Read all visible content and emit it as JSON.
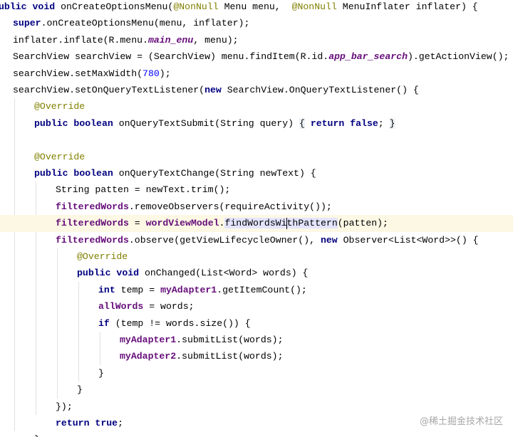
{
  "editor": {
    "lines": [
      {
        "id": "l1",
        "parts": [
          {
            "t": "ublic",
            "c": "kw"
          },
          {
            "t": " "
          },
          {
            "t": "void",
            "c": "kw"
          },
          {
            "t": " onCreateOptionsMenu("
          },
          {
            "t": "@NonNull",
            "c": "ann"
          },
          {
            "t": " Menu menu,  "
          },
          {
            "t": "@NonNull",
            "c": "ann"
          },
          {
            "t": " MenuInflater inflater) {"
          }
        ]
      },
      {
        "id": "l2",
        "parts": [
          {
            "t": "super",
            "c": "kw"
          },
          {
            "t": ".onCreateOptionsMenu(menu, inflater);"
          }
        ]
      },
      {
        "id": "l3",
        "parts": [
          {
            "t": "inflater.inflate(R.menu."
          },
          {
            "t": "main_enu",
            "c": "field-it"
          },
          {
            "t": ", menu);"
          }
        ]
      },
      {
        "id": "l4",
        "parts": [
          {
            "t": "SearchView searchView = (SearchView) menu.findItem(R.id."
          },
          {
            "t": "app_bar_search",
            "c": "field-it"
          },
          {
            "t": ").getActionView();"
          }
        ]
      },
      {
        "id": "l5",
        "parts": [
          {
            "t": "searchView.setMaxWidth("
          },
          {
            "t": "780",
            "c": "num"
          },
          {
            "t": ");"
          }
        ]
      },
      {
        "id": "l6",
        "parts": [
          {
            "t": "searchView.setOnQueryTextListener("
          },
          {
            "t": "new",
            "c": "kw"
          },
          {
            "t": " SearchView.OnQueryTextListener() {"
          }
        ]
      },
      {
        "id": "l7",
        "parts": [
          {
            "t": "@Override",
            "c": "ann"
          }
        ]
      },
      {
        "id": "l8",
        "parts": [
          {
            "t": "public",
            "c": "kw"
          },
          {
            "t": " "
          },
          {
            "t": "boolean",
            "c": "kw"
          },
          {
            "t": " onQueryTextSubmit(String query) "
          },
          {
            "t": "{",
            "c": "brace-hl"
          },
          {
            "t": " "
          },
          {
            "t": "return",
            "c": "kw"
          },
          {
            "t": " "
          },
          {
            "t": "false",
            "c": "kw"
          },
          {
            "t": "; "
          },
          {
            "t": "}",
            "c": "brace-hl"
          }
        ]
      },
      {
        "id": "l9",
        "parts": []
      },
      {
        "id": "l10",
        "parts": [
          {
            "t": "@Override",
            "c": "ann"
          }
        ]
      },
      {
        "id": "l11",
        "parts": [
          {
            "t": "public",
            "c": "kw"
          },
          {
            "t": " "
          },
          {
            "t": "boolean",
            "c": "kw"
          },
          {
            "t": " onQueryTextChange(String newText) {"
          }
        ]
      },
      {
        "id": "l12",
        "parts": [
          {
            "t": "String patten = newText.trim();"
          }
        ]
      },
      {
        "id": "l13",
        "parts": [
          {
            "t": "filteredWords",
            "c": "field"
          },
          {
            "t": ".removeObservers(requireActivity());"
          }
        ]
      },
      {
        "id": "l14",
        "parts": [
          {
            "t": "filteredWords",
            "c": "field"
          },
          {
            "t": " = "
          },
          {
            "t": "wordViewModel",
            "c": "field"
          },
          {
            "t": "."
          },
          {
            "t": "findWordsWi",
            "c": "hl"
          },
          {
            "caret": true
          },
          {
            "t": "thPattern",
            "c": "hl"
          },
          {
            "t": "(patten);"
          }
        ]
      },
      {
        "id": "l15",
        "parts": [
          {
            "t": "filteredWords",
            "c": "field"
          },
          {
            "t": ".observe(getViewLifecycleOwner(), "
          },
          {
            "t": "new",
            "c": "kw"
          },
          {
            "t": " Observer<List<Word>>() {"
          }
        ]
      },
      {
        "id": "l16",
        "parts": [
          {
            "t": "@Override",
            "c": "ann"
          }
        ]
      },
      {
        "id": "l17",
        "parts": [
          {
            "t": "public",
            "c": "kw"
          },
          {
            "t": " "
          },
          {
            "t": "void",
            "c": "kw"
          },
          {
            "t": " onChanged(List<Word> words) {"
          }
        ]
      },
      {
        "id": "l18",
        "parts": [
          {
            "t": "int",
            "c": "kw"
          },
          {
            "t": " temp = "
          },
          {
            "t": "myAdapter1",
            "c": "field"
          },
          {
            "t": ".getItemCount();"
          }
        ]
      },
      {
        "id": "l19",
        "parts": [
          {
            "t": "allWords",
            "c": "field"
          },
          {
            "t": " = words;"
          }
        ]
      },
      {
        "id": "l20",
        "parts": [
          {
            "t": "if",
            "c": "kw"
          },
          {
            "t": " (temp != words.size()) {"
          }
        ]
      },
      {
        "id": "l21",
        "parts": [
          {
            "t": "myAdapter1",
            "c": "field"
          },
          {
            "t": ".submitList(words);"
          }
        ]
      },
      {
        "id": "l22",
        "parts": [
          {
            "t": "myAdapter2",
            "c": "field"
          },
          {
            "t": ".submitList(words);"
          }
        ]
      },
      {
        "id": "l23",
        "parts": [
          {
            "t": "}"
          }
        ]
      },
      {
        "id": "l24",
        "parts": [
          {
            "t": "}"
          }
        ]
      },
      {
        "id": "l25",
        "parts": [
          {
            "t": "});"
          }
        ]
      },
      {
        "id": "l26",
        "parts": [
          {
            "t": "return",
            "c": "kw"
          },
          {
            "t": " "
          },
          {
            "t": "true",
            "c": "kw"
          },
          {
            "t": ";"
          }
        ]
      },
      {
        "id": "l27",
        "parts": [
          {
            "t": "}"
          }
        ]
      }
    ]
  },
  "watermark": "@稀土掘金技术社区"
}
